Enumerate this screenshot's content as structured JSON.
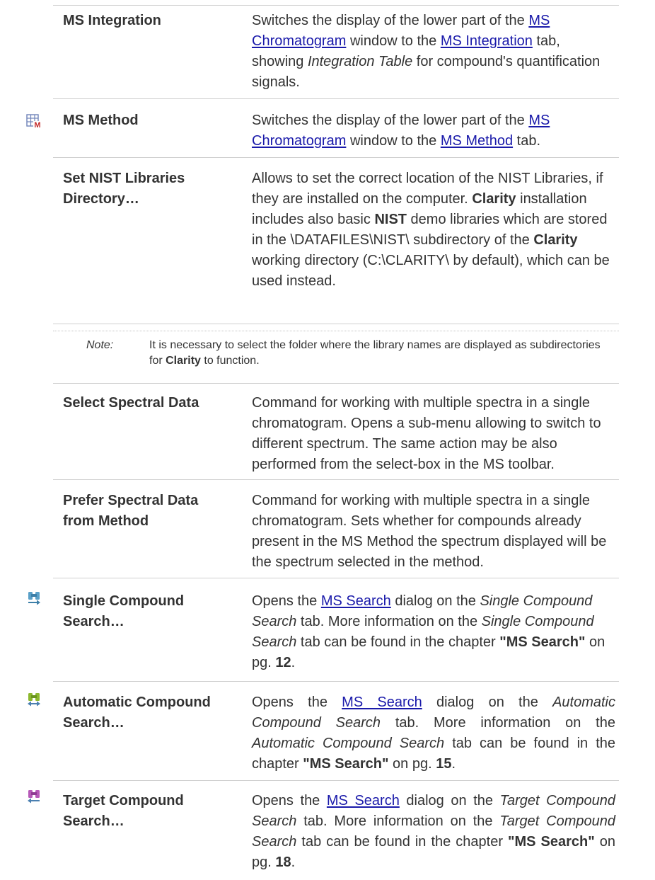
{
  "rows": {
    "ms_integration": {
      "name": "MS Integration",
      "d1": "Switches the display of the lower part of the ",
      "link1": "MS Chromatogram",
      "d2": " window to the ",
      "link2": "MS Integration",
      "d3": " tab, showing ",
      "em": "Integration Table",
      "d4": " for compound's quantification signals."
    },
    "ms_method": {
      "icon": "ms-method-table-icon",
      "name": "MS Method",
      "d1": "Switches the display of the lower part of the ",
      "link1": "MS Chromatogram",
      "d2": " window to the ",
      "link2": "MS Method",
      "d3": " tab."
    },
    "nist": {
      "name": "Set NIST Libraries Directory…",
      "d1": "Allows to set the correct location of the NIST Libraries, if they are installed on the computer. ",
      "b1": "Clarity",
      "d2": " installation includes also basic ",
      "b2": "NIST",
      "d3": " demo libraries which are stored in the \\DATAFILES\\NIST\\ subdirectory of the ",
      "b3": "Clarity",
      "d4": " working directory (C:\\CLARITY\\ by default), which can be used instead."
    },
    "note": {
      "label": "Note:",
      "t1": "It is necessary to select the folder where the library names are displayed as subdirectories for ",
      "b1": "Clarity",
      "t2": " to function."
    },
    "select_spectral": {
      "name": "Select Spectral Data",
      "desc": "Command for working with multiple spectra in a single chromatogram. Opens a sub-menu allowing to switch to different spectrum. The same action may be also performed from the select-box in the MS toolbar."
    },
    "prefer_spectral": {
      "name": "Prefer Spectral Data from Method",
      "desc": "Command for working with multiple spectra in a single chromatogram. Sets whether for compounds already present in the MS Method the spectrum displayed will be the spectrum selected in the method."
    },
    "single_search": {
      "icon": "binoculars-blue-icon",
      "name": "Single Compound Search…",
      "d1": "Opens the ",
      "link": "MS Search",
      "d2": " dialog on the ",
      "em1": "Single Compound Search",
      "d3": " tab. More information on the ",
      "em2": "Single Compound Search",
      "d4": " tab can be found in the chapter ",
      "b1": "\"MS Search\"",
      "d5": " on pg. ",
      "b2": "12",
      "d6": "."
    },
    "auto_search": {
      "icon": "binoculars-green-icon",
      "name": "Automatic Compound Search…",
      "d1": "Opens the ",
      "link": "MS Search",
      "d2": " dialog on the ",
      "em1": "Automatic Compound Search",
      "d3": " tab. More information on the ",
      "em2": "Automatic Compound Search",
      "d4": " tab can be found in the chapter ",
      "b1": "\"MS Search\"",
      "d5": " on pg. ",
      "b2": "15",
      "d6": "."
    },
    "target_search": {
      "icon": "binoculars-purple-icon",
      "name": "Target Compound Search…",
      "d1": "Opens the ",
      "link": "MS Search",
      "d2": " dialog on the ",
      "em1": "Target Compound Search",
      "d3": " tab. More information on the ",
      "em2": "Target Compound Search",
      "d4": " tab can be found in the chapter ",
      "b1": "\"MS Search\"",
      "d5": " on pg. ",
      "b2": "18",
      "d6": "."
    }
  }
}
